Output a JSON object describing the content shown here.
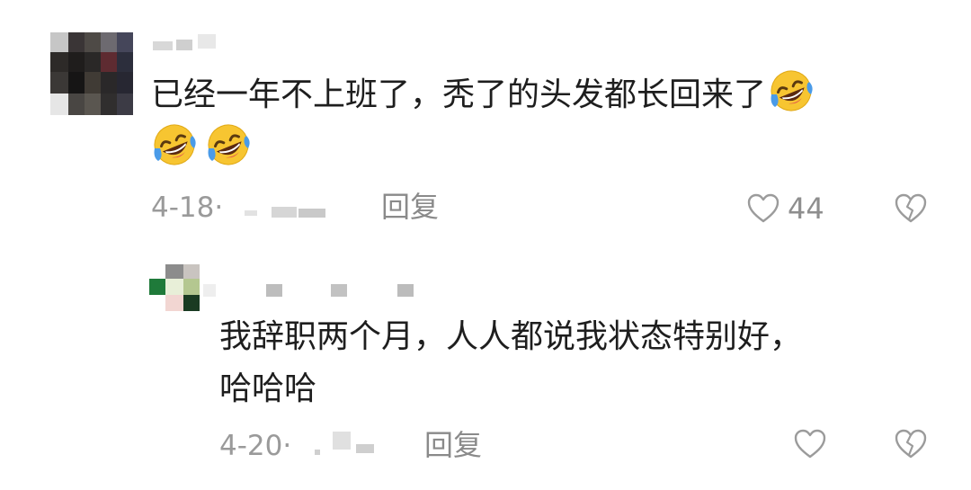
{
  "comments": [
    {
      "text_line1": "已经一年不上班了，秃了的头发都长回来了",
      "date": "4-18",
      "location_separator": "·",
      "reply_label": "回复",
      "like_count": "44",
      "emoji": "rolling-on-floor-laughing-emoji"
    },
    {
      "text_line1": "我辞职两个月，人人都说我状态特别好，",
      "text_line2": "哈哈哈",
      "date": "4-20",
      "location_separator": "·",
      "reply_label": "回复",
      "like_count": ""
    }
  ],
  "colors": {
    "text": "#1e1e1e",
    "meta": "#9a9a9a",
    "icon": "#9b9b9b",
    "emoji_face": "#f7c531",
    "emoji_tear": "#4a9be8"
  },
  "icons": {
    "like": "heart-outline-icon",
    "dislike": "broken-heart-outline-icon"
  }
}
